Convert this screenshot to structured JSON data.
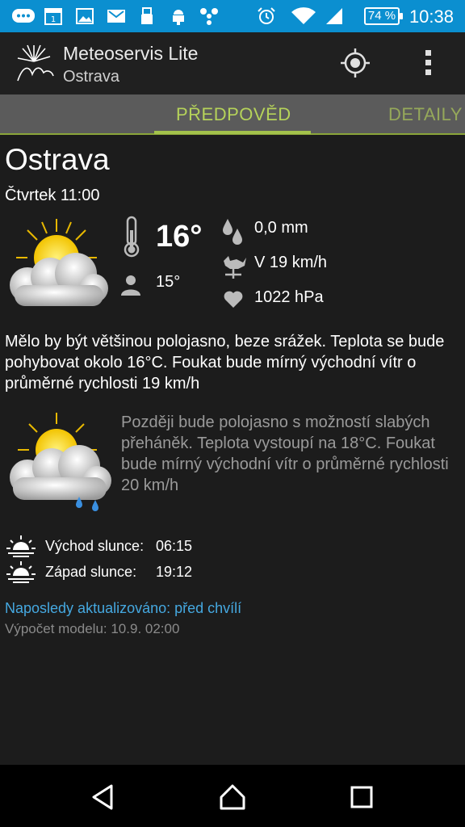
{
  "status_bar": {
    "time": "10:38",
    "battery": "74 %",
    "color": "#0b8fd0"
  },
  "app": {
    "title": "Meteoservis Lite",
    "subtitle": "Ostrava"
  },
  "tabs": [
    {
      "label": "PŘEDPOVĚD",
      "active": true
    },
    {
      "label": "DETAILY",
      "active": false
    }
  ],
  "forecast": {
    "city": "Ostrava",
    "datetime": "Čtvrtek 11:00",
    "temperature": "16°",
    "feels_like": "15°",
    "precipitation": "0,0 mm",
    "wind": "V 19 km/h",
    "pressure": "1022 hPa",
    "description": "Mělo by být většinou polojasno, beze srážek. Teplota se bude pohybovat okolo 16°C. Foukat bude mírný východní vítr o průměrné rychlosti 19 km/h",
    "later_description": "Později bude polojasno s možností slabých přeháněk. Teplota vystoupí na 18°C. Foukat bude mírný východní vítr o průměrné rychlosti 20 km/h"
  },
  "sun": {
    "sunrise_label": "Východ slunce:",
    "sunrise_time": "06:15",
    "sunset_label": "Západ slunce:",
    "sunset_time": "19:12"
  },
  "footer": {
    "updated": "Naposledy aktualizováno: před chvílí",
    "model": "Výpočet modelu: 10.9. 02:00"
  },
  "colors": {
    "accent": "#b5d25a",
    "link": "#45a8e0",
    "background": "#1c1c1c"
  }
}
